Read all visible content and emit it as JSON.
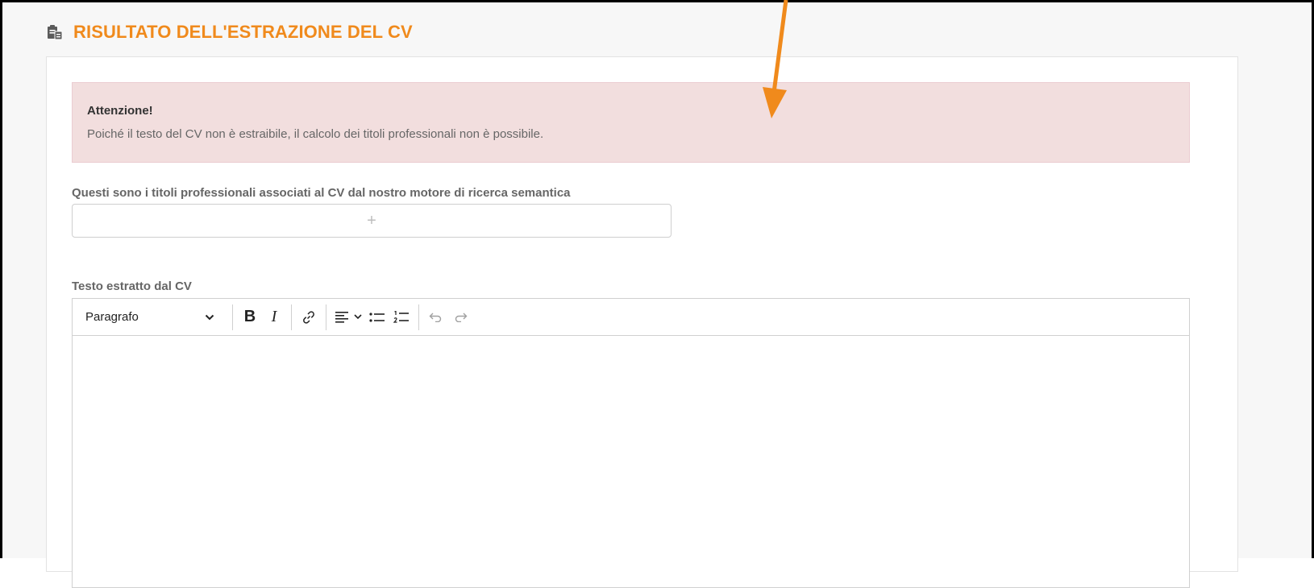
{
  "section": {
    "title": "RISULTATO DELL'ESTRAZIONE DEL CV",
    "icon": "clipboard-files-icon"
  },
  "alert": {
    "title": "Attenzione!",
    "text": "Poiché il testo del CV non è estraibile, il calcolo dei titoli professionali non è possibile."
  },
  "titles_field": {
    "label": "Questi sono i titoli professionali associati al CV dal nostro motore di ricerca semantica",
    "add_glyph": "+"
  },
  "cv_text_field": {
    "label": "Testo estratto dal CV",
    "value": ""
  },
  "toolbar": {
    "paragraph_select": "Paragrafo",
    "bold_glyph": "B",
    "italic_glyph": "I",
    "icons": [
      "bold-icon",
      "italic-icon",
      "link-icon",
      "align-left-icon",
      "bulleted-list-icon",
      "numbered-list-icon",
      "undo-icon",
      "redo-icon"
    ]
  },
  "colors": {
    "accent": "#f08a1c",
    "alert_bg": "#f2dede",
    "annotation_arrow": "#f08a1c"
  }
}
